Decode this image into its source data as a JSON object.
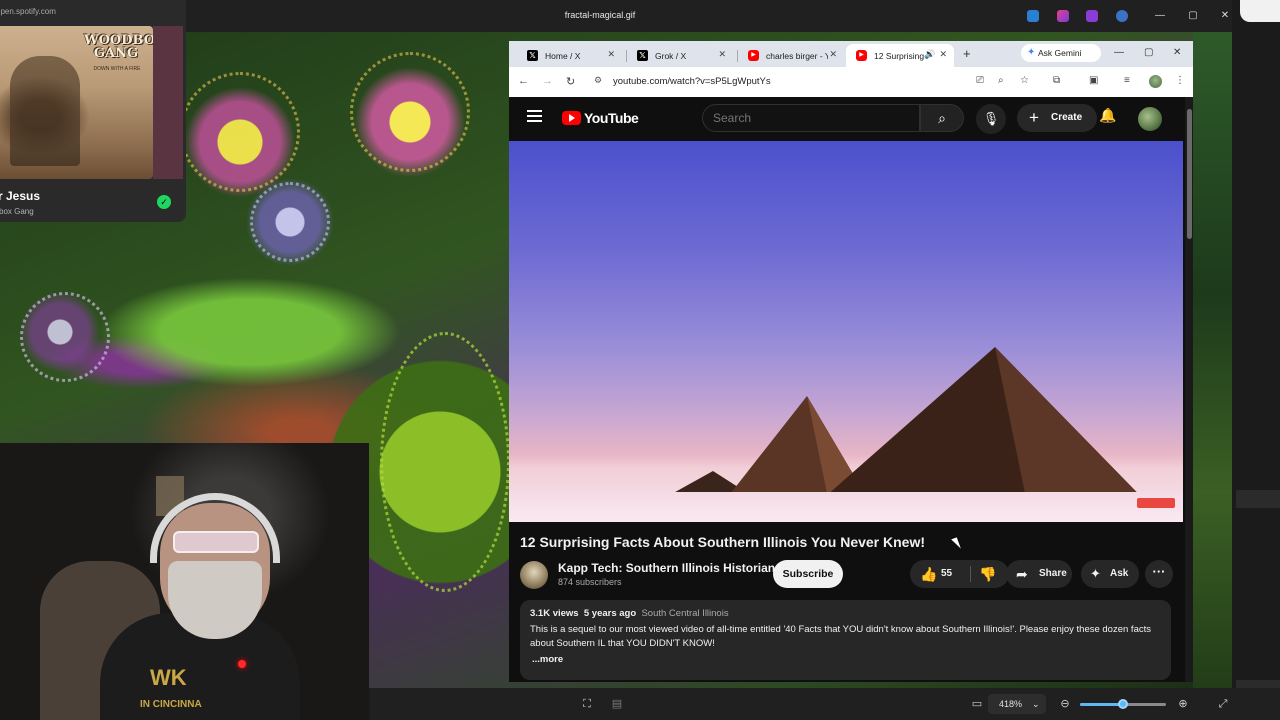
{
  "viewer": {
    "title": "fractal-magical.gif",
    "zoom_level": "418%",
    "zoom_fraction": 0.5
  },
  "spotify": {
    "url": "open.spotify.com",
    "album_art_text": "WOODBOX GANG",
    "album_art_subtext": "DOWN WITH A FIRE",
    "track_title": "r Jesus",
    "artist": "box Gang"
  },
  "webcam": {
    "shirt_text": "WK",
    "shirt_subtext": "IN CINCINNA"
  },
  "chrome": {
    "tabs": [
      {
        "label": "Home / X",
        "favicon": "x-icon",
        "active": false
      },
      {
        "label": "Grok / X",
        "favicon": "x-icon",
        "active": false
      },
      {
        "label": "charles birger - Yo",
        "favicon": "youtube-icon",
        "active": false
      },
      {
        "label": "12 Surprising",
        "favicon": "youtube-icon",
        "active": true,
        "audio": true
      }
    ],
    "ask_gemini": "Ask Gemini",
    "url": "youtube.com/watch?v=sP5LgWputYs"
  },
  "youtube": {
    "logo": "YouTube",
    "search_placeholder": "Search",
    "create_label": "Create",
    "video_title": "12 Surprising Facts About Southern Illinois You Never Knew!",
    "channel_name": "Kapp Tech: Southern Illinois Historian",
    "subscribers": "874 subscribers",
    "subscribe_label": "Subscribe",
    "likes": "55",
    "share_label": "Share",
    "ask_label": "Ask",
    "views": "3.1K views",
    "age": "5 years ago",
    "location_tag": "South Central Illinois",
    "description": "This is a sequel to our most viewed video of all-time entitled '40 Facts that YOU didn't know about Southern Illinois!'.  Please enjoy these dozen facts about Southern IL that YOU DIDN'T KNOW!",
    "more_label": "...more"
  },
  "colors": {
    "youtube_red": "#ff0000",
    "spotify_green": "#1ed760",
    "zoom_accent": "#5fb8f2"
  }
}
